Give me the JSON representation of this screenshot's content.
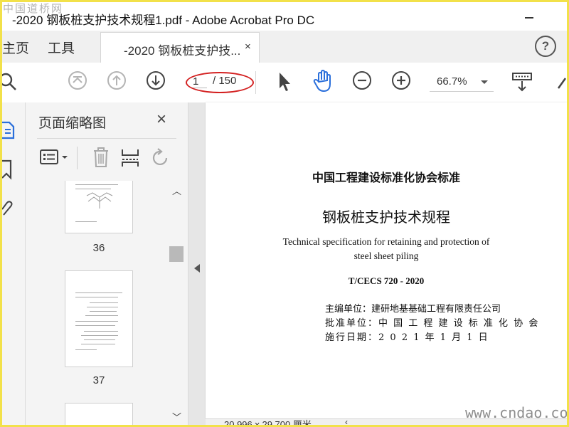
{
  "watermark": {
    "top": "中国道桥网",
    "bottom": "www.cndao.com"
  },
  "window": {
    "title": "-2020 钢板桩支护技术规程1.pdf - Adobe Acrobat Pro DC"
  },
  "tabs": {
    "home": "主页",
    "tools": "工具",
    "document": "-2020 钢板桩支护技...",
    "close": "×",
    "help": "?"
  },
  "toolbar": {
    "current_page": "1",
    "total_pages": "/ 150",
    "zoom": "66.7%",
    "icons": [
      "search-icon",
      "first-page-icon",
      "previous-page-icon",
      "next-page-icon",
      "select-cursor-icon",
      "hand-tool-icon",
      "zoom-out-icon",
      "zoom-in-icon",
      "scroll-mode-icon",
      "link-icon"
    ]
  },
  "panel": {
    "title": "页面缩略图",
    "close": "×",
    "thumbnails": [
      {
        "label": "36"
      },
      {
        "label": "37"
      }
    ]
  },
  "document": {
    "org": "中国工程建设标准化协会标准",
    "title_cn": "钢板桩支护技术规程",
    "title_en_1": "Technical specification for retaining and protection of",
    "title_en_2": "steel sheet piling",
    "code": "T/CECS 720 - 2020",
    "editor": "主编单位：建研地基基础工程有限责任公司",
    "approver": "批准单位：中 国 工 程 建 设 标 准 化 协 会",
    "effective": "施行日期：2 0 2 1 年 1 月 1 日"
  },
  "status": {
    "page_size": "20.996 x 29.700 厘米"
  },
  "colors": {
    "accent": "#2a6fdb",
    "highlight": "#d32020",
    "frame": "#f2e14a"
  }
}
